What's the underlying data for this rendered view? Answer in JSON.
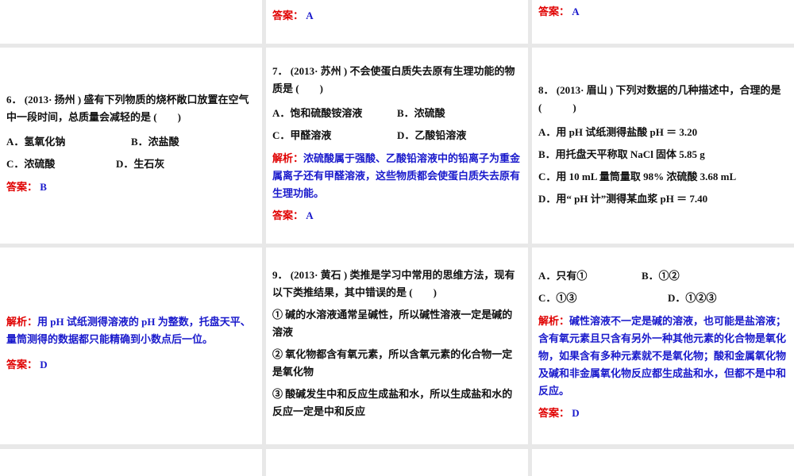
{
  "answer_label": "答案：",
  "analysis_label": "解析：",
  "top_row": {
    "tile2_answer": "A",
    "tile3_answer": "A"
  },
  "q6": {
    "stem": "6． (2013· 扬州 ) 盛有下列物质的烧杯敞口放置在空气中一段时间，总质量会减轻的是 (　　)",
    "options": [
      "A．氢氧化钠",
      "B．浓盐酸",
      "C．浓硫酸",
      "D．生石灰"
    ],
    "answer": "B"
  },
  "q7": {
    "stem": "7． (2013· 苏州 ) 不会使蛋白质失去原有生理功能的物质是 (　　)",
    "options": [
      "A．饱和硫酸铵溶液",
      "B．浓硫酸",
      "C．甲醛溶液",
      "D．乙酸铅溶液"
    ],
    "analysis": "浓硫酸属于强酸、乙酸铅溶液中的铅离子为重金属离子还有甲醛溶液，这些物质都会使蛋白质失去原有生理功能。",
    "answer": "A"
  },
  "q8": {
    "stem": "8． (2013· 眉山 ) 下列对数据的几种描述中，合理的是 (　　　)",
    "options": [
      "A．用 pH 试纸测得盐酸 pH ＝ 3.20",
      "B．用托盘天平称取 NaCl 固体 5.85 g",
      "C．用 10 mL 量筒量取 98% 浓硫酸 3.68 mL",
      "D．用“ pH 计”测得某血浆 pH ＝ 7.40"
    ],
    "analysis": "用 pH 试纸测得溶液的 pH 为整数，托盘天平、量筒测得的数据都只能精确到小数点后一位。",
    "answer": "D"
  },
  "q9": {
    "stem": "9． (2013· 黄石 ) 类推是学习中常用的思维方法，现有以下类推结果，其中错误的是 (　　)",
    "statements": [
      "① 碱的水溶液通常呈碱性，所以碱性溶液一定是碱的溶液",
      "② 氧化物都含有氧元素，所以含氧元素的化合物一定是氧化物",
      "③ 酸碱发生中和反应生成盐和水，所以生成盐和水的反应一定是中和反应"
    ],
    "options": [
      "A．只有①",
      "B．①②",
      "C．①③",
      "D．①②③"
    ],
    "analysis": "碱性溶液不一定是碱的溶液，也可能是盐溶液；含有氧元素且只含有另外一种其他元素的化合物是氧化物，如果含有多种元素就不是氧化物；酸和金属氧化物及碱和非金属氧化物反应都生成盐和水，但都不是中和反应。",
    "answer": "D"
  }
}
